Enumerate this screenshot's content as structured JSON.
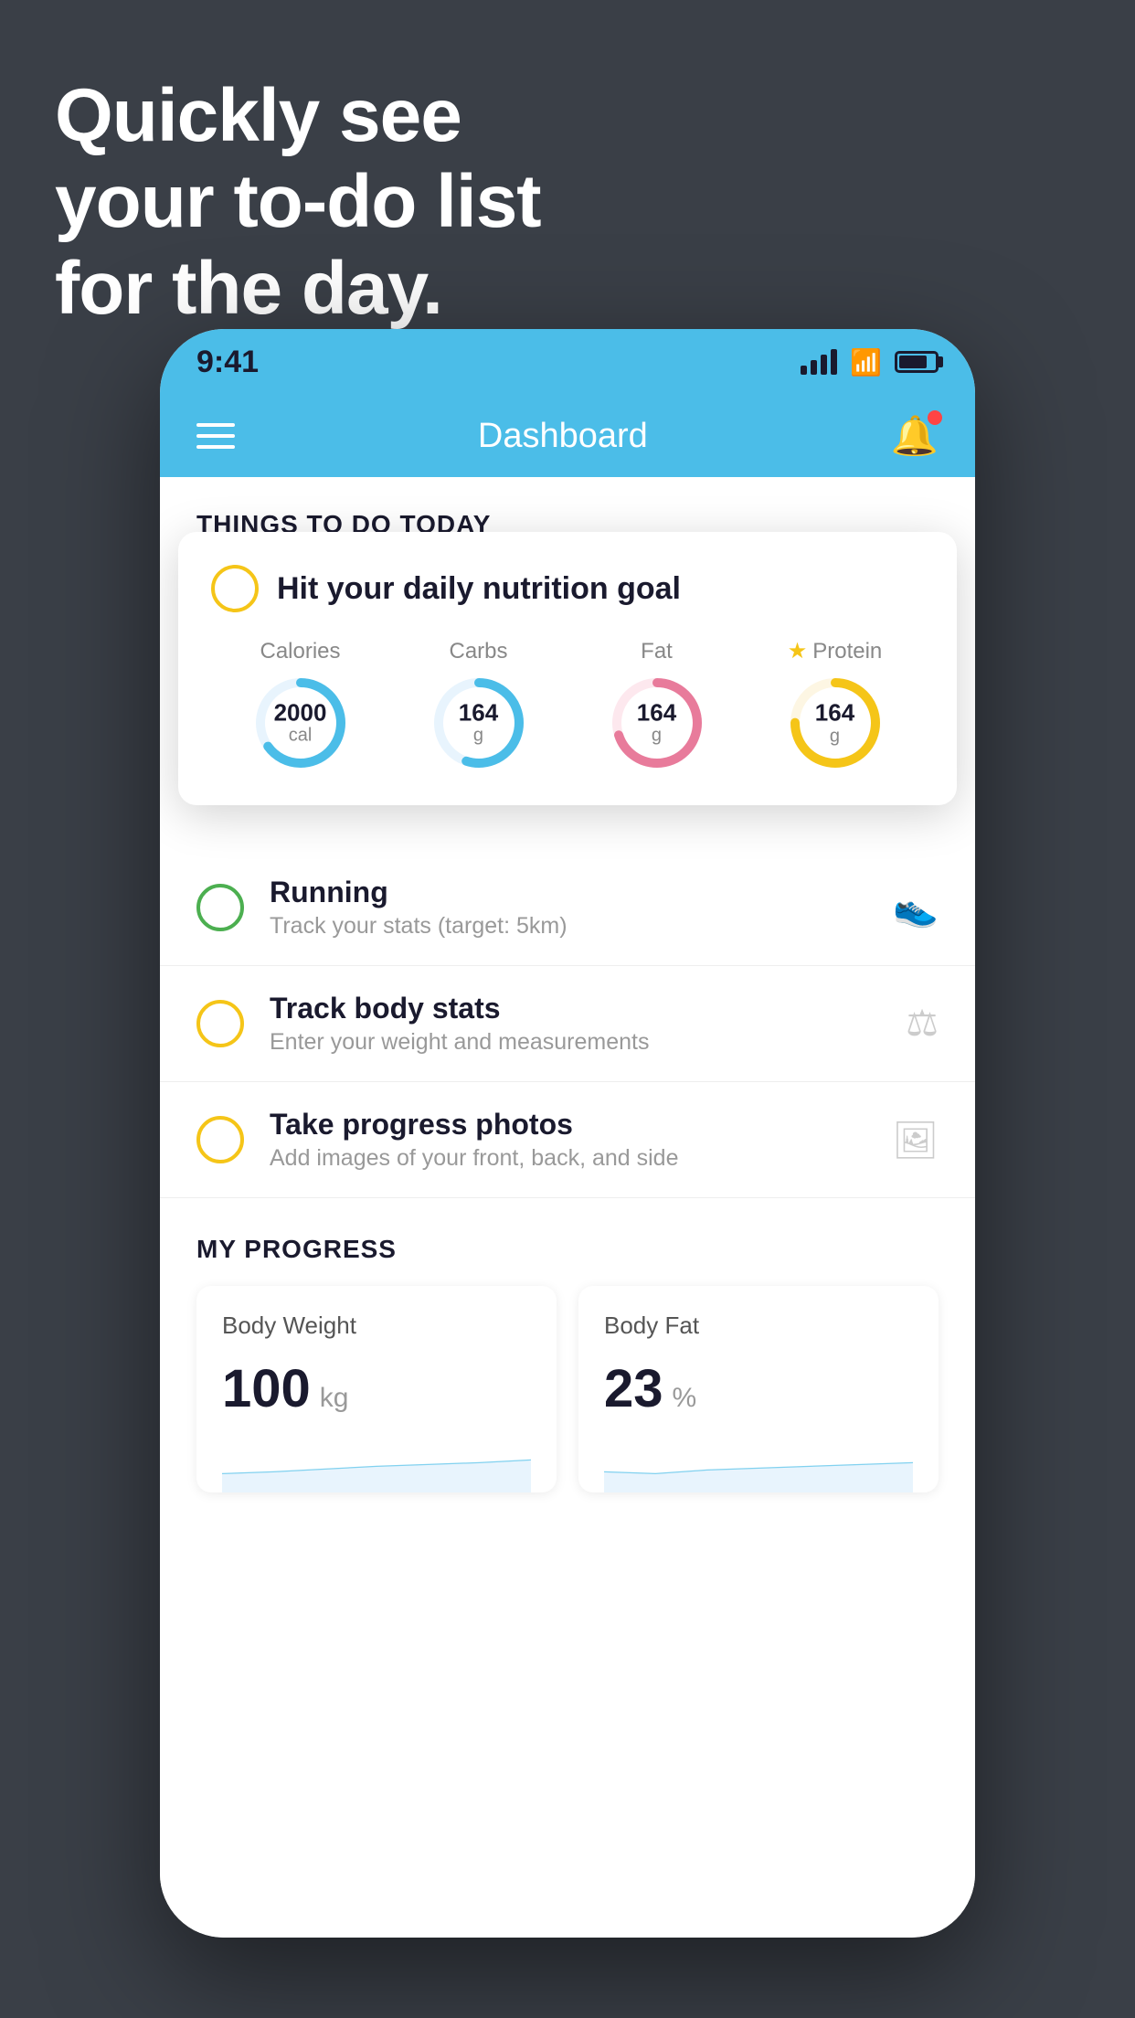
{
  "headline": {
    "line1": "Quickly see",
    "line2": "your to-do list",
    "line3": "for the day."
  },
  "status_bar": {
    "time": "9:41"
  },
  "nav": {
    "title": "Dashboard"
  },
  "things_to_do": {
    "section_label": "THINGS TO DO TODAY"
  },
  "nutrition_card": {
    "title": "Hit your daily nutrition goal",
    "items": [
      {
        "label": "Calories",
        "value": "2000",
        "unit": "cal",
        "color": "#4bbde8",
        "pct": 65
      },
      {
        "label": "Carbs",
        "value": "164",
        "unit": "g",
        "color": "#4bbde8",
        "pct": 55
      },
      {
        "label": "Fat",
        "value": "164",
        "unit": "g",
        "color": "#e87b9b",
        "pct": 70
      },
      {
        "label": "Protein",
        "value": "164",
        "unit": "g",
        "color": "#f5c518",
        "pct": 75
      }
    ]
  },
  "todo_items": [
    {
      "name": "Running",
      "sub": "Track your stats (target: 5km)",
      "circle_color": "green",
      "icon": "👟"
    },
    {
      "name": "Track body stats",
      "sub": "Enter your weight and measurements",
      "circle_color": "yellow",
      "icon": "⚖️"
    },
    {
      "name": "Take progress photos",
      "sub": "Add images of your front, back, and side",
      "circle_color": "yellow2",
      "icon": "🖼️"
    }
  ],
  "progress": {
    "section_label": "MY PROGRESS",
    "cards": [
      {
        "title": "Body Weight",
        "value": "100",
        "unit": "kg"
      },
      {
        "title": "Body Fat",
        "value": "23",
        "unit": "%"
      }
    ]
  }
}
